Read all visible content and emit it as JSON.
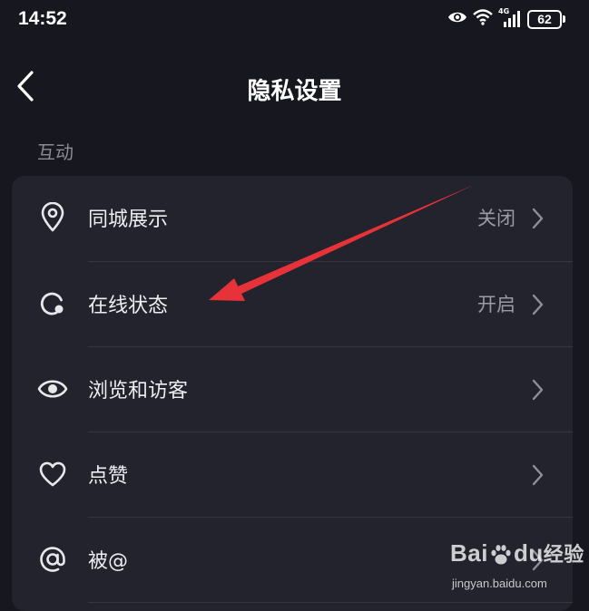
{
  "status_bar": {
    "time": "14:52",
    "network_label": "4G",
    "battery_level": "62",
    "icons": [
      "eye-icon",
      "wifi-icon",
      "signal-icon",
      "battery-icon"
    ]
  },
  "nav": {
    "title": "隐私设置",
    "back_icon": "back-chevron-icon"
  },
  "section": {
    "header": "互动",
    "items": [
      {
        "label": "同城展示",
        "value": "关闭",
        "icon": "location-pin-icon"
      },
      {
        "label": "在线状态",
        "value": "开启",
        "icon": "online-status-icon"
      },
      {
        "label": "浏览和访客",
        "value": "",
        "icon": "eye-icon"
      },
      {
        "label": "点赞",
        "value": "",
        "icon": "heart-icon"
      },
      {
        "label": "被@",
        "value": "",
        "icon": "at-sign-icon"
      }
    ]
  },
  "annotation": {
    "color": "#e8323a",
    "target": "在线状态"
  },
  "watermark": {
    "logo_bai": "Bai",
    "logo_du": "du",
    "logo_suffix": "经验",
    "url": "jingyan.baidu.com"
  },
  "colors": {
    "background": "#16171f",
    "card": "#22232c",
    "text_primary": "#eeeef2",
    "text_secondary": "#9a9ba3"
  }
}
